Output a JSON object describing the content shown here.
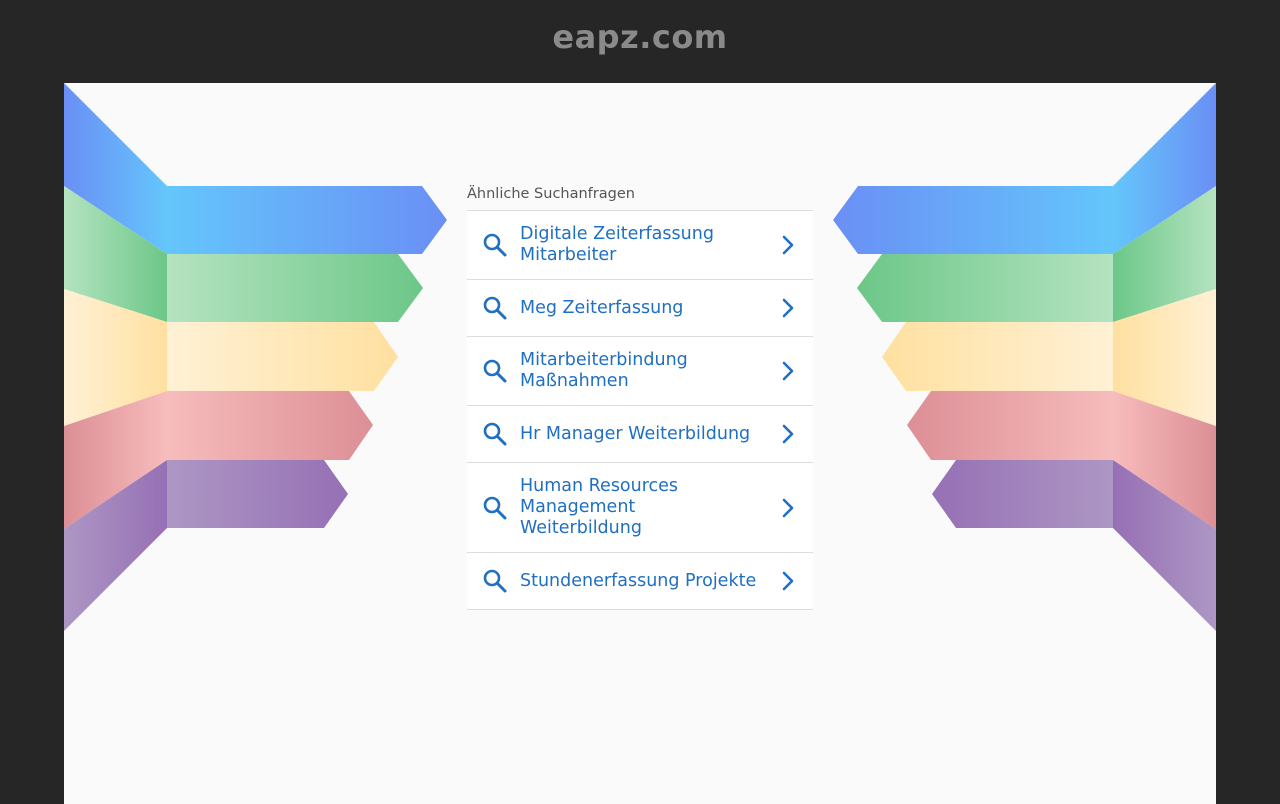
{
  "header": {
    "domain": "eapz.com"
  },
  "related": {
    "heading": "Ähnliche Suchanfragen",
    "items": [
      {
        "label": "Digitale Zeiterfassung Mitarbeiter"
      },
      {
        "label": "Meg Zeiterfassung"
      },
      {
        "label": "Mitarbeiterbindung Maßnahmen"
      },
      {
        "label": "Hr Manager Weiterbildung"
      },
      {
        "label": "Human Resources Management Weiterbildung"
      },
      {
        "label": "Stundenerfassung Projekte"
      }
    ]
  },
  "icons": {
    "search": "search-icon",
    "chevron": "chevron-right-icon"
  },
  "colors": {
    "background": "#262626",
    "panel": "#fafafa",
    "link": "#1f6fc2",
    "stripe_blue": "#64b5f6",
    "stripe_green": "#6cc788",
    "stripe_yellow": "#ffe0a0",
    "stripe_red": "#f4a0a6",
    "stripe_purple": "#9c76b8"
  }
}
